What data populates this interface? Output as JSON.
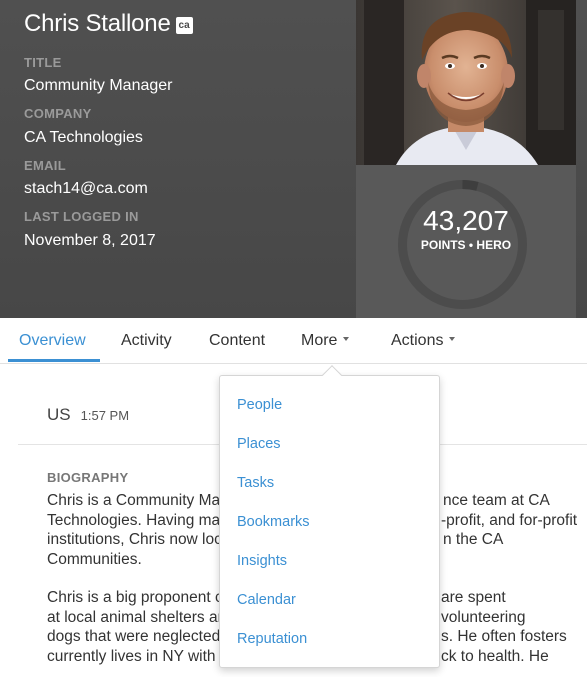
{
  "profile": {
    "name": "Chris Stallone",
    "badge": "ca",
    "fields": [
      {
        "label": "TITLE",
        "value": "Community Manager"
      },
      {
        "label": "COMPANY",
        "value": "CA Technologies"
      },
      {
        "label": "EMAIL",
        "value": "stach14@ca.com"
      },
      {
        "label": "LAST LOGGED IN",
        "value": "November 8, 2017"
      }
    ],
    "points": "43,207",
    "points_label": "POINTS • HERO",
    "points_ring_progress": 0.04
  },
  "tabs": {
    "overview": "Overview",
    "activity": "Activity",
    "content": "Content",
    "more": "More",
    "actions": "Actions"
  },
  "status": {
    "location": "US",
    "time": "1:57 PM"
  },
  "biography": {
    "heading": "BIOGRAPHY",
    "p1_lines": [
      "Chris is a Community Ma",
      "Technologies. Having ma",
      "institutions, Chris now loc",
      "Communities."
    ],
    "p1_right_lines": [
      "nce team at CA",
      "-profit, and for-profit",
      "n the CA"
    ],
    "p2_lines": [
      "Chris is a big proponent c",
      "at local animal shelters ar",
      "dogs that were neglected",
      "currently lives in NY with"
    ],
    "p2_right_lines": [
      "are spent volunteering",
      "s. He often fosters",
      "ck to health. He"
    ]
  },
  "more_menu": {
    "items": [
      "People",
      "Places",
      "Tasks",
      "Bookmarks",
      "Insights",
      "Calendar",
      "Reputation"
    ]
  },
  "colors": {
    "header_bg": "#4a4a4a",
    "points_bg": "#595959",
    "accent": "#3b90d3"
  }
}
